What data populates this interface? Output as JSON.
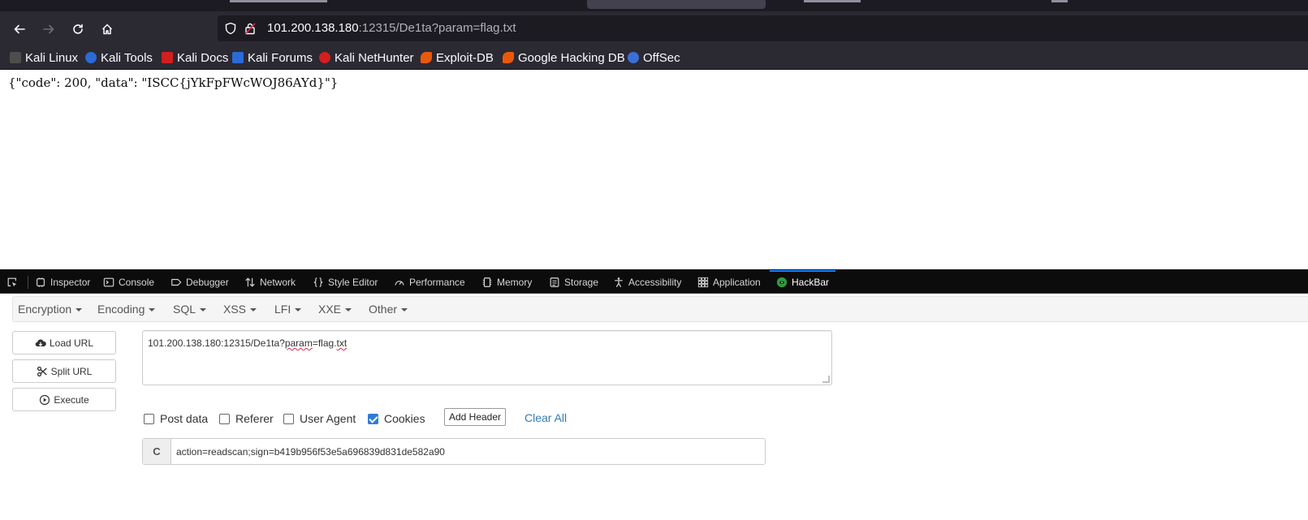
{
  "browser": {
    "url": {
      "host": "101.200.138.180",
      "rest": ":12315/De1ta?param=flag.txt"
    },
    "bookmarks": [
      {
        "label": "Kali Linux",
        "icon": "kali-dragon-icon",
        "color": "#6b6b6b"
      },
      {
        "label": "Kali Tools",
        "icon": "kali-tools-icon",
        "color": "#2b6bd6"
      },
      {
        "label": "Kali Docs",
        "icon": "kali-docs-icon",
        "color": "#d21f1f"
      },
      {
        "label": "Kali Forums",
        "icon": "kali-forums-icon",
        "color": "#2b6bd6"
      },
      {
        "label": "Kali NetHunter",
        "icon": "nethunter-icon",
        "color": "#d21f1f"
      },
      {
        "label": "Exploit-DB",
        "icon": "exploit-db-icon",
        "color": "#e8590c"
      },
      {
        "label": "Google Hacking DB",
        "icon": "ghdb-icon",
        "color": "#e8590c"
      },
      {
        "label": "OffSec",
        "icon": "offsec-icon",
        "color": "#3b6fd8"
      }
    ]
  },
  "page": {
    "response_text": "{\"code\": 200, \"data\": \"ISCC{jYkFpFWcWOJ86AYd}\"}"
  },
  "devtools": {
    "tabs": [
      {
        "label": "Inspector",
        "icon": "inspector-icon"
      },
      {
        "label": "Console",
        "icon": "console-icon"
      },
      {
        "label": "Debugger",
        "icon": "debugger-icon"
      },
      {
        "label": "Network",
        "icon": "network-icon"
      },
      {
        "label": "Style Editor",
        "icon": "style-editor-icon"
      },
      {
        "label": "Performance",
        "icon": "performance-icon"
      },
      {
        "label": "Memory",
        "icon": "memory-icon"
      },
      {
        "label": "Storage",
        "icon": "storage-icon"
      },
      {
        "label": "Accessibility",
        "icon": "accessibility-icon"
      },
      {
        "label": "Application",
        "icon": "application-icon"
      },
      {
        "label": "HackBar",
        "icon": "hackbar-icon",
        "active": true
      }
    ]
  },
  "hackbar": {
    "menus": [
      "Encryption",
      "Encoding",
      "SQL",
      "XSS",
      "LFI",
      "XXE",
      "Other"
    ],
    "buttons": {
      "load_url": "Load URL",
      "split_url": "Split URL",
      "execute": "Execute"
    },
    "url_field": {
      "prefix": "101.200.138.180:12315/De1ta?",
      "word1": "param",
      "mid": "=flag.",
      "word2": "txt"
    },
    "options": {
      "post_data": {
        "label": "Post data",
        "checked": false
      },
      "referer": {
        "label": "Referer",
        "checked": false
      },
      "user_agent": {
        "label": "User Agent",
        "checked": false
      },
      "cookies": {
        "label": "Cookies",
        "checked": true
      }
    },
    "add_header_label": "Add Header",
    "clear_all_label": "Clear All",
    "cookie_addon_label": "C",
    "cookie_value": "action=readscan;sign=b419b956f53e5a696839d831de582a90"
  }
}
